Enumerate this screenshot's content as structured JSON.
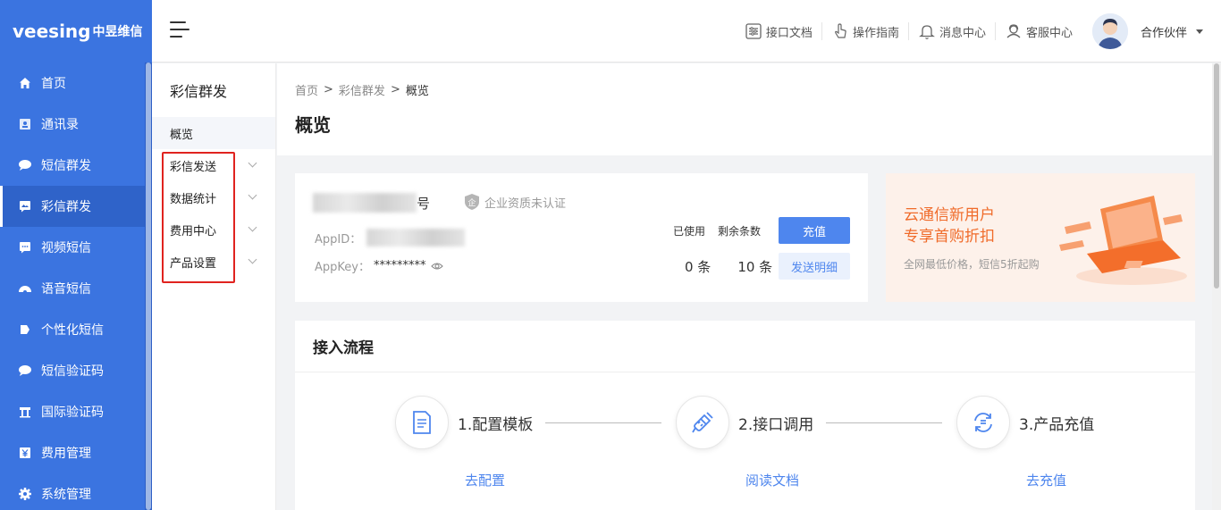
{
  "brand": {
    "name": "veesing",
    "sub": "中昱维信"
  },
  "sidebar": {
    "items": [
      {
        "label": "首页",
        "icon": "home-icon"
      },
      {
        "label": "通讯录",
        "icon": "contacts-icon"
      },
      {
        "label": "短信群发",
        "icon": "sms-icon"
      },
      {
        "label": "彩信群发",
        "icon": "mms-icon",
        "active": true
      },
      {
        "label": "视频短信",
        "icon": "video-sms-icon"
      },
      {
        "label": "语音短信",
        "icon": "voice-sms-icon"
      },
      {
        "label": "个性化短信",
        "icon": "personalized-sms-icon"
      },
      {
        "label": "短信验证码",
        "icon": "sms-code-icon"
      },
      {
        "label": "国际验证码",
        "icon": "international-code-icon"
      },
      {
        "label": "费用管理",
        "icon": "yen-icon"
      },
      {
        "label": "系统管理",
        "icon": "gear-icon"
      }
    ]
  },
  "header": {
    "links": [
      {
        "label": "接口文档",
        "icon": "api-doc-icon"
      },
      {
        "label": "操作指南",
        "icon": "hand-pointer-icon"
      },
      {
        "label": "消息中心",
        "icon": "bell-icon"
      },
      {
        "label": "客服中心",
        "icon": "support-icon"
      }
    ],
    "user": "合作伙伴"
  },
  "submenu": {
    "title": "彩信群发",
    "items": [
      {
        "label": "概览",
        "active": true
      },
      {
        "label": "彩信发送"
      },
      {
        "label": "数据统计"
      },
      {
        "label": "费用中心"
      },
      {
        "label": "产品设置"
      }
    ]
  },
  "breadcrumb": {
    "home": "首页",
    "parent": "彩信群发",
    "current": "概览",
    "sep": ">"
  },
  "page_title": "概览",
  "account": {
    "name_suffix": "号",
    "cert_status": "企业资质未认证",
    "appid_label": "AppID：",
    "appkey_label": "AppKey：",
    "appkey_mask": "*********",
    "used_label": "已使用",
    "remaining_label": "剩余条数",
    "used_value": "0 条",
    "remaining_value": "10 条",
    "recharge_button": "充值",
    "detail_button": "发送明细"
  },
  "promo": {
    "line1": "云通信新用户",
    "line2": "专享首购折扣",
    "sub": "全网最低价格，短信5折起购"
  },
  "flow": {
    "title": "接入流程",
    "steps": [
      {
        "label": "1.配置模板",
        "link": "去配置",
        "icon": "document-icon"
      },
      {
        "label": "2.接口调用",
        "link": "阅读文档",
        "icon": "plug-icon"
      },
      {
        "label": "3.产品充值",
        "link": "去充值",
        "icon": "refresh-icon"
      }
    ]
  },
  "colors": {
    "primary": "#3b74e0",
    "accent": "#4e86ee",
    "promo": "#f06b2a",
    "highlight": "#e0231f"
  }
}
